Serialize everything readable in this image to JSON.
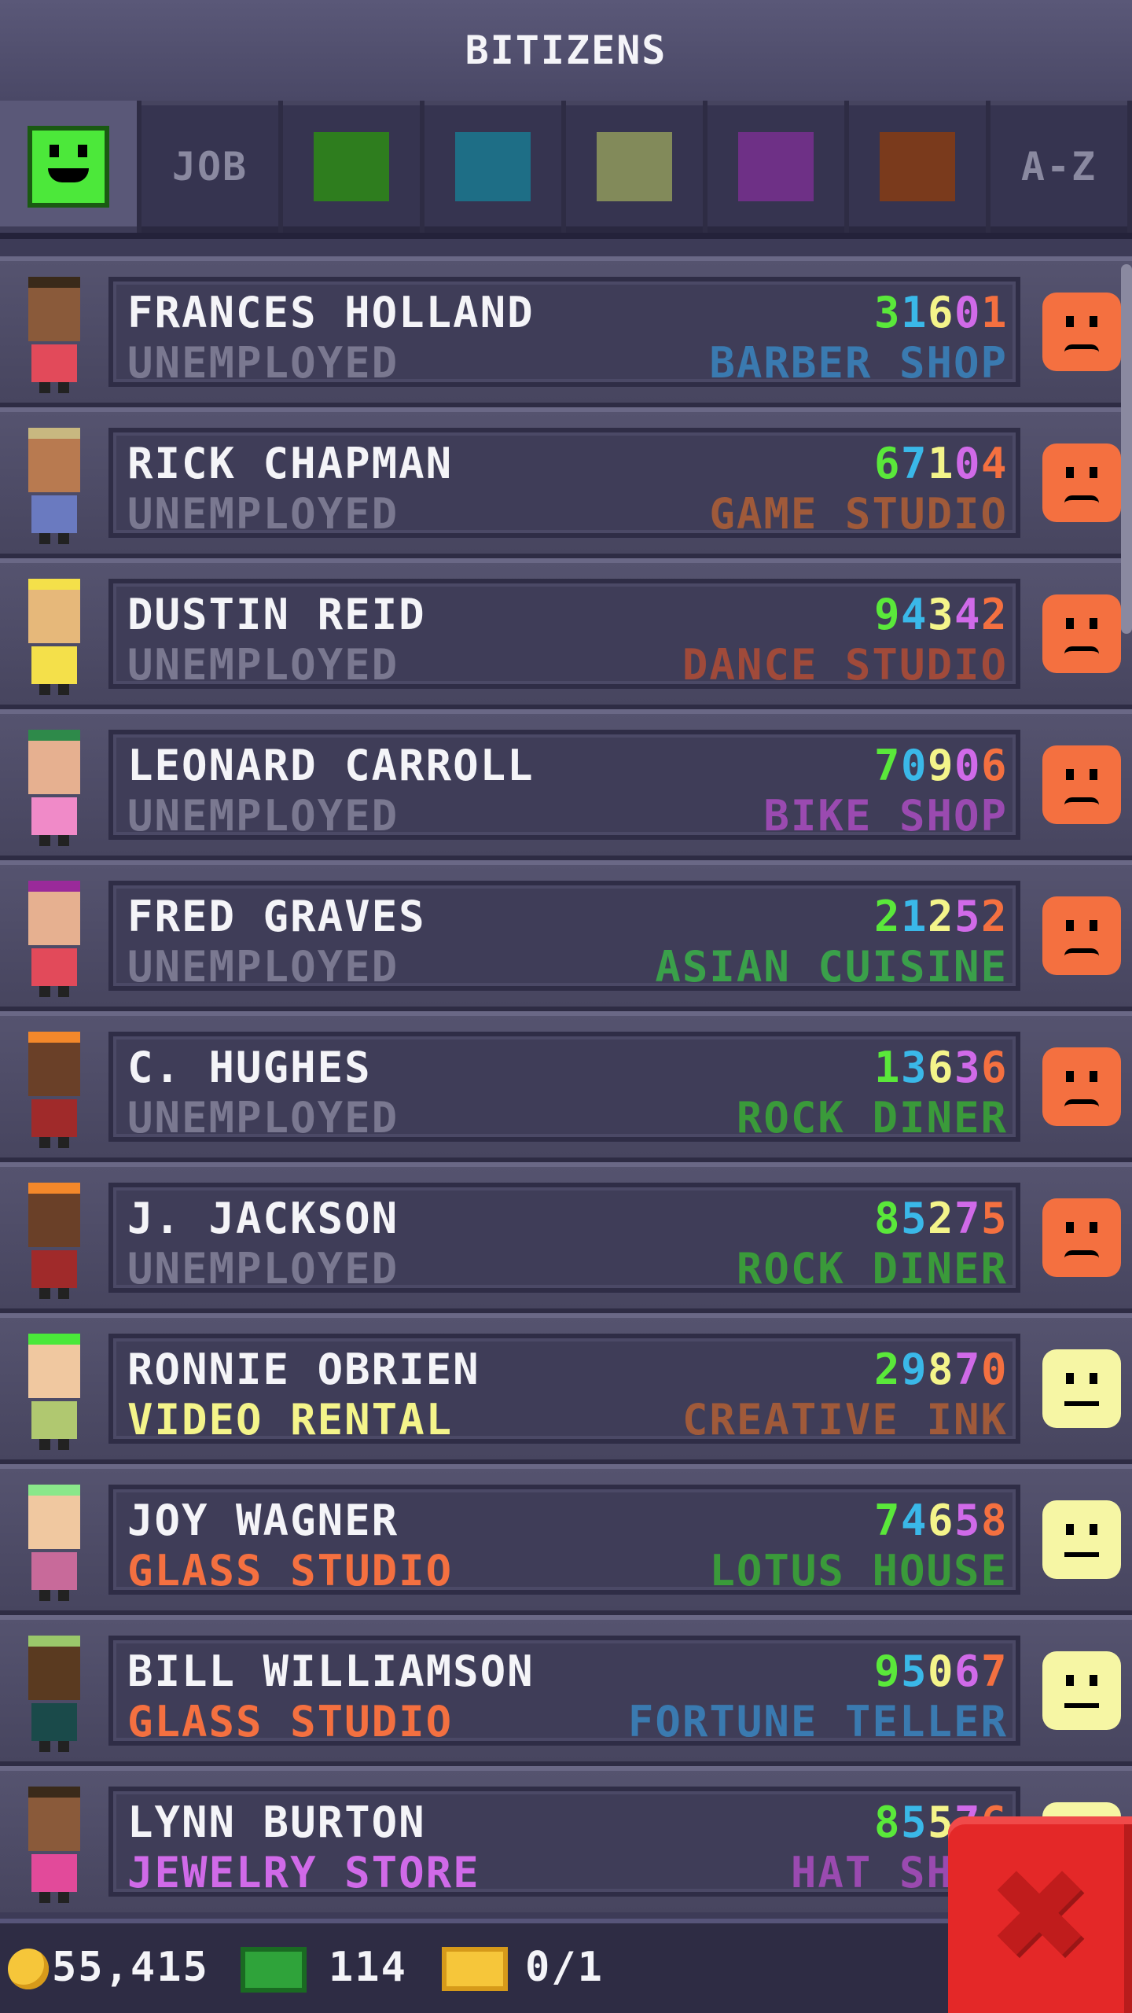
{
  "title": "BITIZENS",
  "tabs": [
    {
      "kind": "mood",
      "color": "#4ce83a"
    },
    {
      "kind": "text",
      "label": "JOB"
    },
    {
      "kind": "swatch",
      "color": "#2e7d1e"
    },
    {
      "kind": "swatch",
      "color": "#1e6e86"
    },
    {
      "kind": "swatch",
      "color": "#828a5a"
    },
    {
      "kind": "swatch",
      "color": "#6e3086"
    },
    {
      "kind": "swatch",
      "color": "#7a3a1c"
    },
    {
      "kind": "text",
      "label": "A-Z"
    }
  ],
  "bitizens": [
    {
      "name": "FRANCES HOLLAND",
      "job": "UNEMPLOYED",
      "job_color": "#7a7890",
      "code": [
        "3",
        "1",
        "6",
        "0",
        "1"
      ],
      "dream": "BARBER SHOP",
      "dream_color": "#3a7ab0",
      "mood": "unhappy",
      "skin": "#8a5a3a",
      "hair": "#3a2a1a",
      "shirt": "#e24a5a"
    },
    {
      "name": "RICK CHAPMAN",
      "job": "UNEMPLOYED",
      "job_color": "#7a7890",
      "code": [
        "6",
        "7",
        "1",
        "0",
        "4"
      ],
      "dream": "GAME STUDIO",
      "dream_color": "#a05a3a",
      "mood": "unhappy",
      "skin": "#b87a50",
      "hair": "#c8b880",
      "shirt": "#6a7ac0"
    },
    {
      "name": "DUSTIN REID",
      "job": "UNEMPLOYED",
      "job_color": "#7a7890",
      "code": [
        "9",
        "4",
        "3",
        "4",
        "2"
      ],
      "dream": "DANCE STUDIO",
      "dream_color": "#a04a3a",
      "mood": "unhappy",
      "skin": "#e6b87a",
      "hair": "#f4e04a",
      "shirt": "#f4e04a"
    },
    {
      "name": "LEONARD CARROLL",
      "job": "UNEMPLOYED",
      "job_color": "#7a7890",
      "code": [
        "7",
        "0",
        "9",
        "0",
        "6"
      ],
      "dream": "BIKE SHOP",
      "dream_color": "#9a4ab0",
      "mood": "unhappy",
      "skin": "#e6b090",
      "hair": "#2e8a4a",
      "shirt": "#f08ac8"
    },
    {
      "name": "FRED GRAVES",
      "job": "UNEMPLOYED",
      "job_color": "#7a7890",
      "code": [
        "2",
        "1",
        "2",
        "5",
        "2"
      ],
      "dream": "ASIAN CUISINE",
      "dream_color": "#3aa04a",
      "mood": "unhappy",
      "skin": "#e6b090",
      "hair": "#9a2a9a",
      "shirt": "#e24a5a"
    },
    {
      "name": "C. HUGHES",
      "job": "UNEMPLOYED",
      "job_color": "#7a7890",
      "code": [
        "1",
        "3",
        "6",
        "3",
        "6"
      ],
      "dream": "ROCK DINER",
      "dream_color": "#3a9a3a",
      "mood": "unhappy",
      "skin": "#6a4028",
      "hair": "#f4882a",
      "shirt": "#a02a2a"
    },
    {
      "name": "J. JACKSON",
      "job": "UNEMPLOYED",
      "job_color": "#7a7890",
      "code": [
        "8",
        "5",
        "2",
        "7",
        "5"
      ],
      "dream": "ROCK DINER",
      "dream_color": "#3a9a3a",
      "mood": "unhappy",
      "skin": "#6a4028",
      "hair": "#f4882a",
      "shirt": "#a02a2a"
    },
    {
      "name": "RONNIE OBRIEN",
      "job": "VIDEO RENTAL",
      "job_color": "#f4f48a",
      "code": [
        "2",
        "9",
        "8",
        "7",
        "0"
      ],
      "dream": "CREATIVE INK",
      "dream_color": "#a05a3a",
      "mood": "neutral",
      "skin": "#f0c8a0",
      "hair": "#4ae83a",
      "shirt": "#b0c870"
    },
    {
      "name": "JOY WAGNER",
      "job": "GLASS STUDIO",
      "job_color": "#f47040",
      "code": [
        "7",
        "4",
        "6",
        "5",
        "8"
      ],
      "dream": "LOTUS HOUSE",
      "dream_color": "#3a9a3a",
      "mood": "neutral",
      "skin": "#f0c8a0",
      "hair": "#8ae88a",
      "shirt": "#c86a9a"
    },
    {
      "name": "BILL WILLIAMSON",
      "job": "GLASS STUDIO",
      "job_color": "#f47040",
      "code": [
        "9",
        "5",
        "0",
        "6",
        "7"
      ],
      "dream": "FORTUNE TELLER",
      "dream_color": "#3a7ab0",
      "mood": "neutral",
      "skin": "#5a3a20",
      "hair": "#9ac86a",
      "shirt": "#1a4a4a"
    },
    {
      "name": "LYNN BURTON",
      "job": "JEWELRY STORE",
      "job_color": "#d06ae8",
      "code": [
        "8",
        "5",
        "5",
        "7",
        "6"
      ],
      "dream": "HAT SHOP",
      "dream_color": "#9a4ab0",
      "mood": "neutral",
      "skin": "#8a5a3a",
      "hair": "#3a2a1a",
      "shirt": "#e24a9a"
    }
  ],
  "code_colors": [
    "#5ae83a",
    "#3ab8e8",
    "#f4f48a",
    "#d06ae8",
    "#f47040"
  ],
  "footer": {
    "coins": "55,415",
    "bux": "114",
    "vip": "0/1"
  }
}
